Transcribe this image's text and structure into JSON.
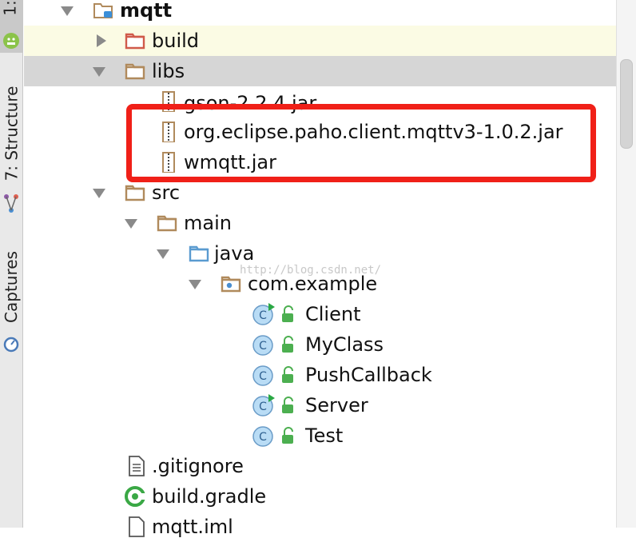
{
  "side_tabs": {
    "project": "1:",
    "structure": "7: Structure",
    "captures": "Captures"
  },
  "tree": {
    "mqtt": "mqtt",
    "build": "build",
    "libs": "libs",
    "gson": "gson-2.2.4.jar",
    "paho": "org.eclipse.paho.client.mqttv3-1.0.2.jar",
    "wmqtt": "wmqtt.jar",
    "src": "src",
    "main": "main",
    "java": "java",
    "package": "com.example",
    "classes": [
      "Client",
      "MyClass",
      "PushCallback",
      "Server",
      "Test"
    ],
    "gitignore": ".gitignore",
    "build_gradle": "build.gradle",
    "mqtt_iml": "mqtt.iml"
  },
  "watermark": "http://blog.csdn.net/",
  "colors": {
    "highlight_box": "#f02018",
    "selected_row": "#d6d6d6",
    "current_row": "#fbfbe4",
    "class_icon": "#b9dcf5",
    "run_marker": "#2aa844",
    "access_lock": "#4caf50"
  }
}
